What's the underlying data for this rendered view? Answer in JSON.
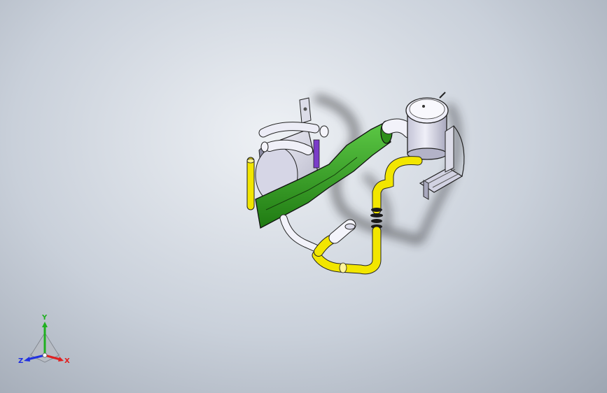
{
  "viewport": {
    "background": "#b8c0cb"
  },
  "assembly": {
    "pipe_yellow": "#f2e600",
    "duct_green": "#33a51f",
    "housing_gray": "#d9d9e6",
    "edge_color": "#1a1a1a"
  },
  "triad": {
    "x_label": "X",
    "y_label": "Y",
    "z_label": "Z",
    "x_color": "#e02020",
    "y_color": "#20b020",
    "z_color": "#2030e0"
  }
}
